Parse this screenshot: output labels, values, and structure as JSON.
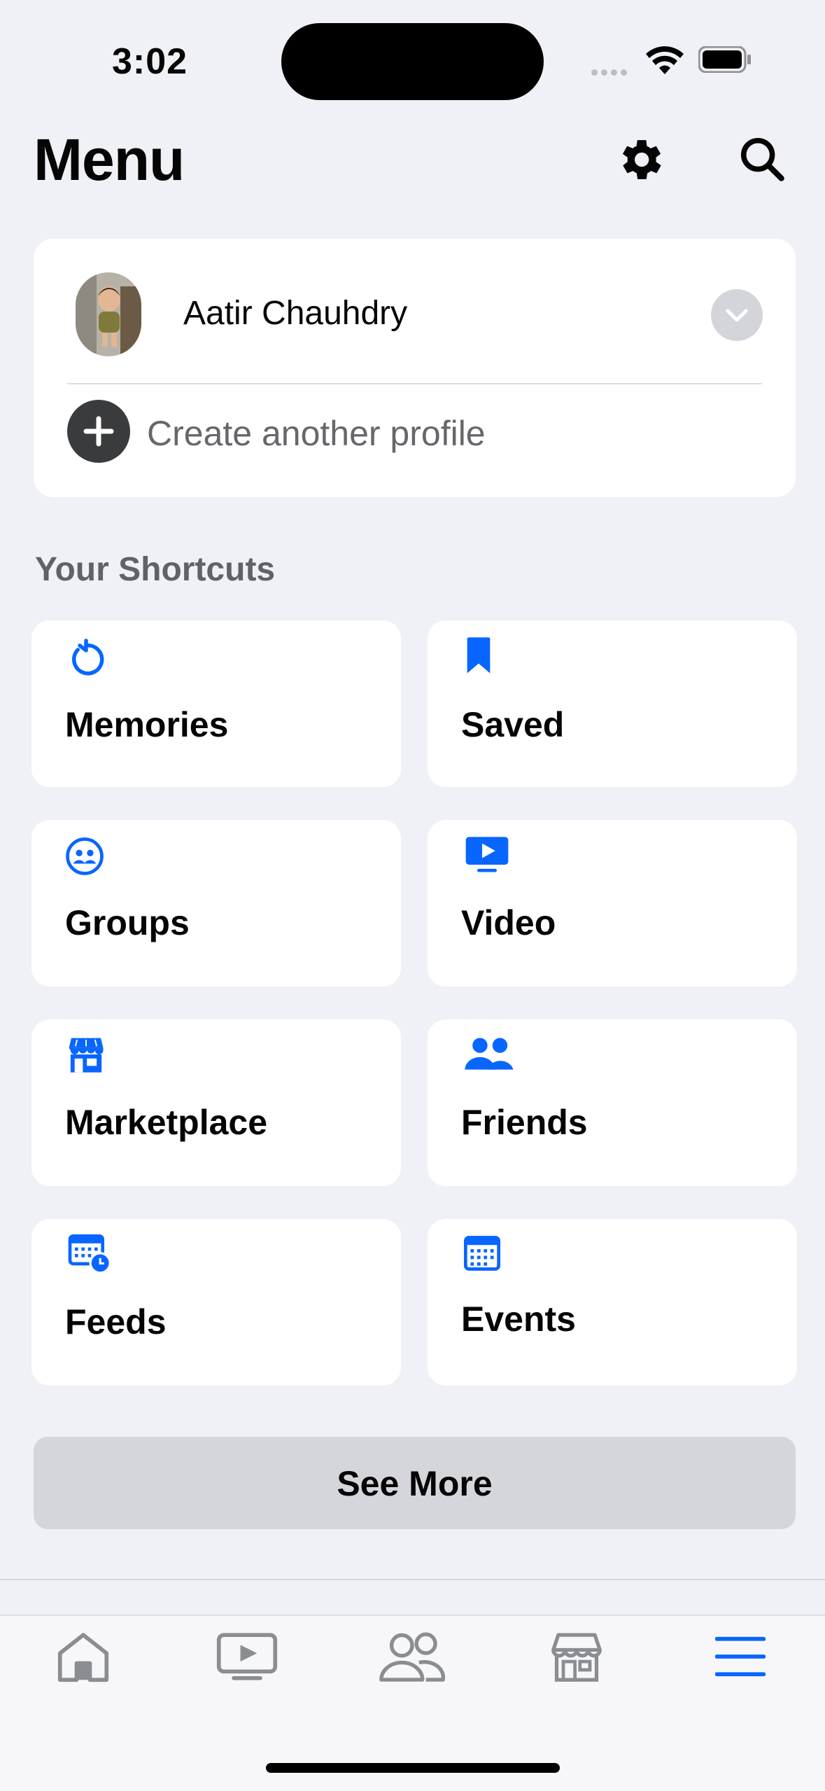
{
  "status_bar": {
    "time": "3:02"
  },
  "header": {
    "title": "Menu",
    "settings_icon": "gear-icon",
    "search_icon": "search-icon"
  },
  "profile": {
    "name": "Aatir Chauhdry",
    "create_label": "Create another profile"
  },
  "shortcuts": {
    "title": "Your Shortcuts",
    "items": [
      {
        "label": "Memories",
        "icon": "memories-icon"
      },
      {
        "label": "Saved",
        "icon": "bookmark-icon"
      },
      {
        "label": "Groups",
        "icon": "groups-icon"
      },
      {
        "label": "Video",
        "icon": "video-icon"
      },
      {
        "label": "Marketplace",
        "icon": "marketplace-icon"
      },
      {
        "label": "Friends",
        "icon": "friends-icon"
      },
      {
        "label": "Feeds",
        "icon": "feeds-icon"
      },
      {
        "label": "Events",
        "icon": "calendar-icon"
      }
    ],
    "see_more": "See More"
  },
  "tab_bar": {
    "tabs": [
      "home",
      "video",
      "friends",
      "marketplace",
      "menu"
    ],
    "active": "menu"
  },
  "colors": {
    "accent": "#0866ff",
    "background": "#f0f1f6",
    "card": "#ffffff",
    "inactive_icon": "#8a8d91"
  }
}
